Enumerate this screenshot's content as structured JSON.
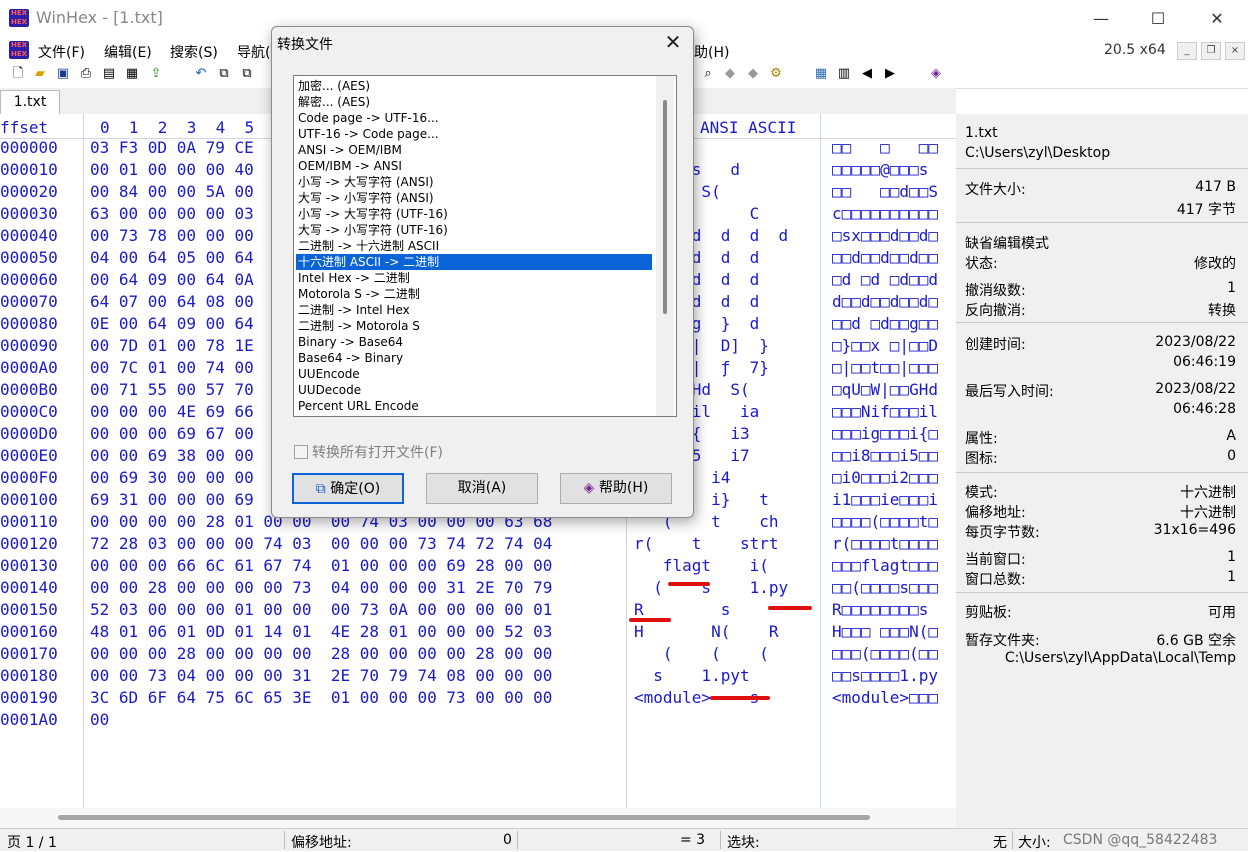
{
  "window": {
    "app_title": "WinHex - [1.txt]",
    "version": "20.5 x64",
    "minimize": "—",
    "maximize": "☐",
    "close": "✕"
  },
  "menu": [
    "文件(F)",
    "编辑(E)",
    "搜索(S)",
    "导航(",
    "助(H)"
  ],
  "tabs": [
    "1.txt"
  ],
  "hex": {
    "header_offset": "ffset",
    "header_columns": "0  1  2  3  4  5",
    "header_text": "ANSI ASCII",
    "rows": [
      {
        "off": "000000",
        "hex": "03 F3 0D 0A 79 CE",
        "ansi": "  É Xc",
        "ascii": "□□   □   □□"
      },
      {
        "off": "000010",
        "hex": "00 01 00 00 00 40",
        "ansi": "  @   s   d",
        "ascii": "□□□□□@□□□s "
      },
      {
        "off": "000020",
        "hex": "00 84 00 00 5A 00",
        "ansi": "    d  S(",
        "ascii": "□□   □□d□□S"
      },
      {
        "off": "000030",
        "hex": "63 00 00 00 00 03",
        "ansi": "            C",
        "ascii": "c□□□□□□□□□□"
      },
      {
        "off": "000040",
        "hex": "00 73 78 00 00 00",
        "ansi": "   d  d  d  d  d",
        "ascii": "□sx□□□d□□d□"
      },
      {
        "off": "000050",
        "hex": "04 00 64 05 00 64",
        "ansi": "   d  d  d  d",
        "ascii": "□□d□□d□□d□□"
      },
      {
        "off": "000060",
        "hex": "00 64 09 00 64 0A",
        "ansi": "   d  d  d  d",
        "ascii": "□d □d □d□□d"
      },
      {
        "off": "000070",
        "hex": "64 07 00 64 08 00",
        "ansi": "   d  d  d  d",
        "ascii": "d□□d□□d□□d□"
      },
      {
        "off": "000080",
        "hex": "0E 00 64 09 00 64",
        "ansi": "   d  g  }  d",
        "ascii": "□□d □d□□g□□"
      },
      {
        "off": "000090",
        "hex": "00 7D 01 00 78 1E",
        "ansi": "      |  D]  }",
        "ascii": "□}□□x □|□□D"
      },
      {
        "off": "0000A0",
        "hex": "00 7C 01 00 74 00",
        "ansi": "      |  ƒ  7}",
        "ascii": "□|□□t□□|□□□"
      },
      {
        "off": "0000B0",
        "hex": "00 71 55 00 57 70",
        "ansi": "  |  GHd  S(",
        "ascii": "□qU□W|□□GHd"
      },
      {
        "off": "0000C0",
        "hex": "00 00 00 4E 69 66",
        "ansi": "  f   il   ia",
        "ascii": "□□□Nif□□□il"
      },
      {
        "off": "0000D0",
        "hex": "00 00 00 69 67 00",
        "ansi": "     i{   i3",
        "ascii": "□□□ig□□□i{□"
      },
      {
        "off": "0000E0",
        "hex": "00 00 69 38 00 00",
        "ansi": "     i5   i7",
        "ascii": "□□i8□□□i5□□"
      },
      {
        "off": "0000F0",
        "hex": "00 69 30 00 00 00",
        "ansi": "   i2   i4",
        "ascii": "□i0□□□i2□□□"
      },
      {
        "off": "000100",
        "hex": "69 31 00 00 00 69",
        "ansi": "  ie    i}   t",
        "ascii": "i1□□□ie□□□i"
      },
      {
        "off": "000110",
        "hex": "00 00 00 00 28 01 00 00  00 74 03 00 00 00 63 68",
        "ansi": "   (    t    ch",
        "ascii": "□□□□(□□□□t□"
      },
      {
        "off": "000120",
        "hex": "72 28 03 00 00 00 74 03  00 00 00 73 74 72 74 04",
        "ansi": "r(    t    strt",
        "ascii": "r(□□□□t□□□□"
      },
      {
        "off": "000130",
        "hex": "00 00 00 66 6C 61 67 74  01 00 00 00 69 28 00 00",
        "ansi": "   flagt    i(",
        "ascii": "□□□flagt□□□"
      },
      {
        "off": "000140",
        "hex": "00 00 28 00 00 00 00 73  04 00 00 00 31 2E 70 79",
        "ansi": "  (    s    1.py",
        "ascii": "□□(□□□□s□□□"
      },
      {
        "off": "000150",
        "hex": "52 03 00 00 00 01 00 00  00 73 0A 00 00 00 00 01",
        "ansi": "R        s",
        "ascii": "R□□□□□□□□s "
      },
      {
        "off": "000160",
        "hex": "48 01 06 01 0D 01 14 01  4E 28 01 00 00 00 52 03",
        "ansi": "H       N(    R",
        "ascii": "H□□□ □□□N(□"
      },
      {
        "off": "000170",
        "hex": "00 00 00 28 00 00 00 00  28 00 00 00 00 28 00 00",
        "ansi": "   (    (    (",
        "ascii": "□□□(□□□□(□□"
      },
      {
        "off": "000180",
        "hex": "00 00 73 04 00 00 00 31  2E 70 79 74 08 00 00 00",
        "ansi": "  s    1.pyt",
        "ascii": "□□s□□□□1.py"
      },
      {
        "off": "000190",
        "hex": "3C 6D 6F 64 75 6C 65 3E  01 00 00 00 73 00 00 00",
        "ansi": "<module>    s",
        "ascii": "<module>□□□"
      },
      {
        "off": "0001A0",
        "hex": "00",
        "ansi": "",
        "ascii": ""
      }
    ]
  },
  "info": {
    "file_name": "1.txt",
    "file_path": "C:\\Users\\zyl\\Desktop",
    "size_label": "文件大小:",
    "size_bytes": "417 B",
    "size_chars": "417 字节",
    "default_edit_mode": "缺省编辑模式",
    "state_label": "状态:",
    "state_value": "修改的",
    "undo_label": "撤消级数:",
    "undo_value": "1",
    "reverse_undo_label": "反向撤消:",
    "reverse_undo_value": "转换",
    "created_label": "创建时间:",
    "created_date": "2023/08/22",
    "created_time": "06:46:19",
    "written_label": "最后写入时间:",
    "written_date": "2023/08/22",
    "written_time": "06:46:28",
    "attr_label": "属性:",
    "attr_value": "A",
    "icon_label": "图标:",
    "icon_value": "0",
    "mode_label": "模式:",
    "mode_value": "十六进制",
    "offset_label": "偏移地址:",
    "offset_value": "十六进制",
    "bpp_label": "每页字节数:",
    "bpp_value": "31x16=496",
    "curwin_label": "当前窗口:",
    "curwin_value": "1",
    "totalwin_label": "窗口总数:",
    "totalwin_value": "1",
    "clipboard_label": "剪贴板:",
    "clipboard_value": "可用",
    "temp_label": "暂存文件夹:",
    "temp_value": "6.6 GB 空余",
    "temp_path": "C:\\Users\\zyl\\AppData\\Local\\Temp"
  },
  "status": {
    "page": "页 1 / 1",
    "offset_label": "偏移地址:",
    "offset_value": "0",
    "eq": "= 3",
    "block_label": "选块:",
    "none": "无",
    "size_label": "大小:",
    "watermark": "CSDN @qq_58422483"
  },
  "dialog": {
    "title": "转换文件",
    "items": [
      "加密... (AES)",
      "解密... (AES)",
      "Code page -> UTF-16...",
      "UTF-16 -> Code page...",
      "ANSI -> OEM/IBM",
      "OEM/IBM -> ANSI",
      "小写 -> 大写字符 (ANSI)",
      "大写 -> 小写字符 (ANSI)",
      "小写 -> 大写字符 (UTF-16)",
      "大写 -> 小写字符 (UTF-16)",
      "二进制 -> 十六进制 ASCII",
      "十六进制 ASCII -> 二进制",
      "Intel Hex -> 二进制",
      "Motorola S -> 二进制",
      "二进制 -> Intel Hex",
      "二进制 -> Motorola S",
      "Binary -> Base64",
      "Base64 -> Binary",
      "UUEncode",
      "UUDecode",
      "Percent URL Encode"
    ],
    "selected_index": 11,
    "checkbox_label": "转换所有打开文件(F)",
    "ok": "确定(O)",
    "cancel": "取消(A)",
    "help": "帮助(H)"
  }
}
